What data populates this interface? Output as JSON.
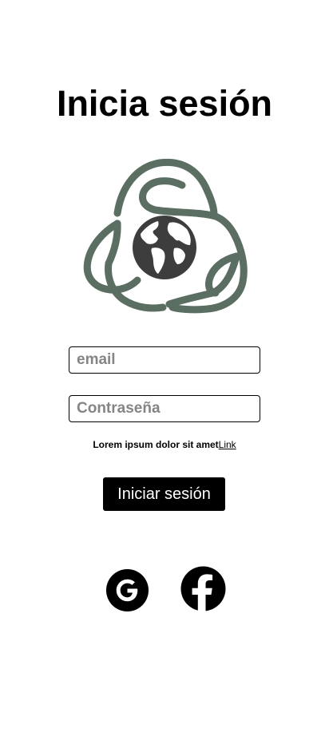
{
  "header": {
    "title": "Inicia sesión"
  },
  "logo": {
    "icon": "recycle-leaves-globe-icon",
    "leaf_color": "#5a6f62",
    "globe_color": "#3d3d3d"
  },
  "form": {
    "email_placeholder": "email",
    "password_placeholder": "Contraseña",
    "helper_text": "Lorem ipsum dolor sit amet",
    "helper_link": "Link",
    "submit_label": "Iniciar sesión"
  },
  "social": {
    "google_icon": "google-icon",
    "facebook_icon": "facebook-icon"
  }
}
